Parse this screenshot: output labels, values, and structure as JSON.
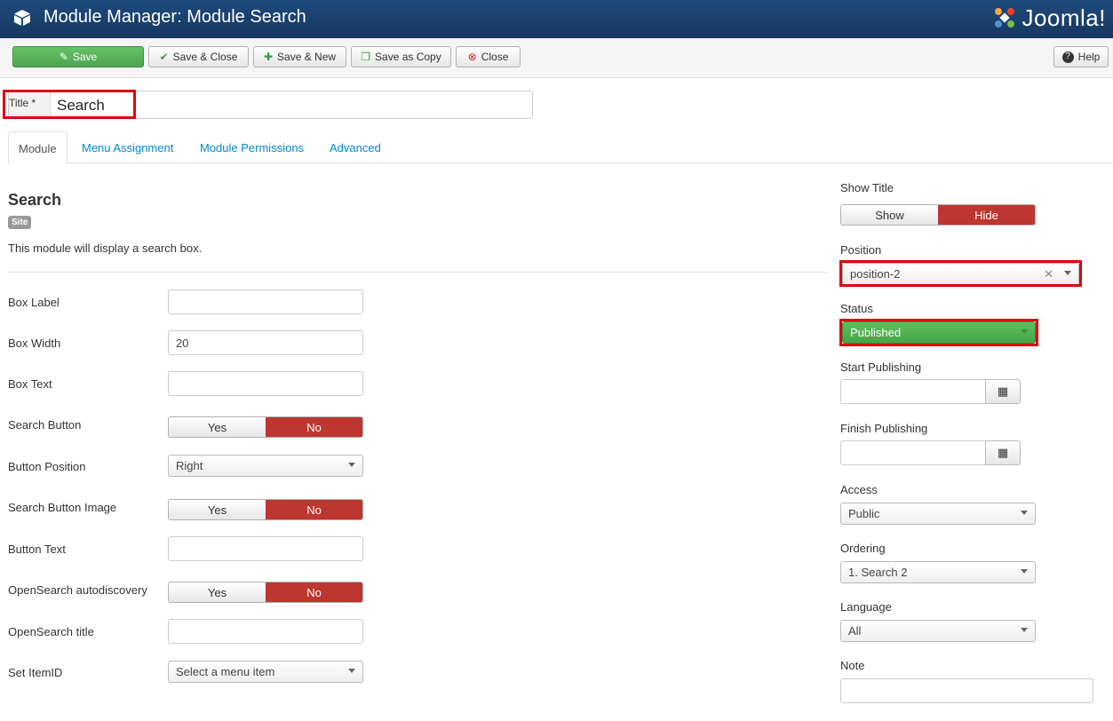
{
  "header": {
    "title": "Module Manager: Module Search",
    "logo_text": "Joomla!",
    "icon": "cube-icon"
  },
  "toolbar": {
    "save": "Save",
    "save_close": "Save & Close",
    "save_new": "Save & New",
    "save_copy": "Save as Copy",
    "close": "Close",
    "help": "Help"
  },
  "title_field": {
    "label": "Title *",
    "value": "Search"
  },
  "tabs": [
    "Module",
    "Menu Assignment",
    "Module Permissions",
    "Advanced"
  ],
  "module": {
    "name": "Search",
    "badge": "Site",
    "description": "This module will display a search box."
  },
  "fields": {
    "box_label": {
      "label": "Box Label",
      "value": ""
    },
    "box_width": {
      "label": "Box Width",
      "value": "20"
    },
    "box_text": {
      "label": "Box Text",
      "value": ""
    },
    "search_button": {
      "label": "Search Button",
      "yes": "Yes",
      "no": "No",
      "selected": "No"
    },
    "button_position": {
      "label": "Button Position",
      "value": "Right"
    },
    "search_button_image": {
      "label": "Search Button Image",
      "yes": "Yes",
      "no": "No",
      "selected": "No"
    },
    "button_text": {
      "label": "Button Text",
      "value": ""
    },
    "opensearch_auto": {
      "label": "OpenSearch autodiscovery",
      "yes": "Yes",
      "no": "No",
      "selected": "No"
    },
    "opensearch_title": {
      "label": "OpenSearch title",
      "value": ""
    },
    "set_itemid": {
      "label": "Set ItemID",
      "value": "Select a menu item"
    }
  },
  "sidebar": {
    "show_title": {
      "label": "Show Title",
      "show": "Show",
      "hide": "Hide",
      "selected": "Hide"
    },
    "position": {
      "label": "Position",
      "value": "position-2"
    },
    "status": {
      "label": "Status",
      "value": "Published"
    },
    "start_publishing": {
      "label": "Start Publishing",
      "value": ""
    },
    "finish_publishing": {
      "label": "Finish Publishing",
      "value": ""
    },
    "access": {
      "label": "Access",
      "value": "Public"
    },
    "ordering": {
      "label": "Ordering",
      "value": "1. Search 2"
    },
    "language": {
      "label": "Language",
      "value": "All"
    },
    "note": {
      "label": "Note",
      "value": ""
    }
  },
  "colors": {
    "header_bg": "#1e4a7d",
    "save_green": "#51a351",
    "toggle_red": "#bd362f",
    "highlight_red": "#e00010",
    "link_blue": "#0088cc"
  }
}
